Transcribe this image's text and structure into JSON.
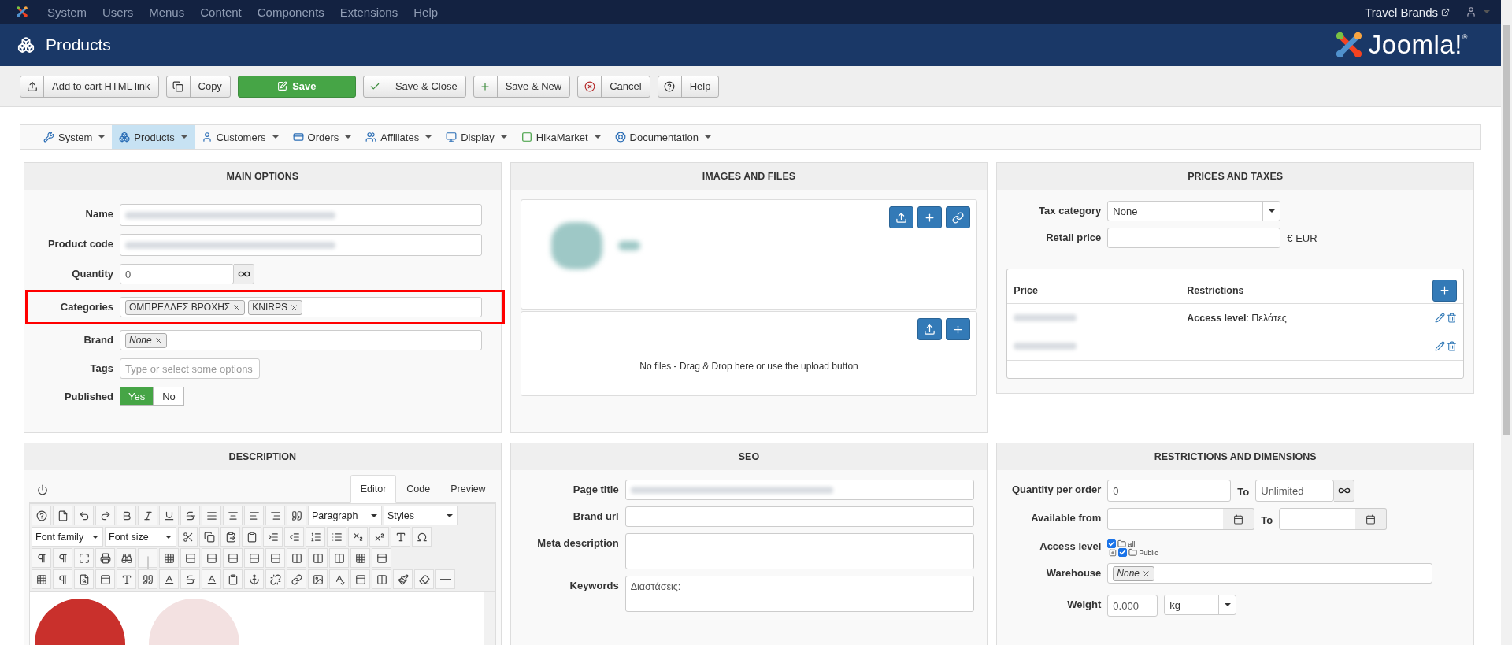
{
  "topbar": {
    "menu": [
      "System",
      "Users",
      "Menus",
      "Content",
      "Components",
      "Extensions",
      "Help"
    ],
    "site_link": "Travel Brands"
  },
  "header": {
    "title": "Products",
    "logo_text": "Joomla!$^{®}$"
  },
  "toolbar": [
    {
      "label": "Add to cart HTML link",
      "kind": "upload"
    },
    {
      "label": "Copy",
      "kind": "copy"
    },
    {
      "label": "Save",
      "kind": "save"
    },
    {
      "label": "Save & Close",
      "kind": "check"
    },
    {
      "label": "Save & New",
      "kind": "plus"
    },
    {
      "label": "Cancel",
      "kind": "cancel"
    },
    {
      "label": "Help",
      "kind": "help"
    }
  ],
  "submenu": [
    {
      "label": "System",
      "kind": "wrench",
      "selected": false
    },
    {
      "label": "Products",
      "kind": "boxes",
      "selected": true
    },
    {
      "label": "Customers",
      "kind": "user",
      "selected": false
    },
    {
      "label": "Orders",
      "kind": "card",
      "selected": false
    },
    {
      "label": "Affiliates",
      "kind": "users",
      "selected": false
    },
    {
      "label": "Display",
      "kind": "monitor",
      "selected": false
    },
    {
      "label": "HikaMarket",
      "kind": "market",
      "selected": false
    },
    {
      "label": "Documentation",
      "kind": "lifebuoy",
      "selected": false
    }
  ],
  "main_options": {
    "title": "MAIN OPTIONS",
    "fields": [
      {
        "label": "Name",
        "kind": "blurred",
        "highlighted": false
      },
      {
        "label": "Product code",
        "kind": "blurred",
        "highlighted": false
      },
      {
        "label": "Quantity",
        "kind": "quantity",
        "value": "0",
        "highlighted": false
      },
      {
        "label": "Categories",
        "kind": "tags",
        "tags": [
          "ΟΜΠΡΕΛΛΕΣ ΒΡΟΧΗΣ",
          "KNIRPS"
        ],
        "highlighted": true
      },
      {
        "label": "Brand",
        "kind": "select",
        "tags": [
          "None"
        ],
        "highlighted": false
      },
      {
        "label": "Tags",
        "kind": "input",
        "placeholder": "Type or select some options",
        "highlighted": false
      },
      {
        "label": "Published",
        "kind": "toggle",
        "options": [
          {
            "label": "Yes",
            "selected": true
          },
          {
            "label": "No",
            "selected": false
          }
        ],
        "highlighted": false
      }
    ]
  },
  "images": {
    "title": "IMAGES AND FILES",
    "files_text": "No files - Drag & Drop here or use the upload button"
  },
  "prices": {
    "title": "PRICES AND TAXES",
    "tax_category": {
      "label": "Tax category",
      "value": "None"
    },
    "retail_price": {
      "label": "Retail price",
      "unit": "€ EUR"
    },
    "table": {
      "columns": [
        "Price",
        "Restrictions"
      ],
      "rows": [
        {
          "restriction": "**Access level**: Πελάτες"
        },
        {}
      ]
    }
  },
  "description": {
    "title": "DESCRIPTION",
    "tabs": [
      {
        "label": "Editor",
        "selected": true
      },
      {
        "label": "Code",
        "selected": false
      },
      {
        "label": "Preview",
        "selected": false
      }
    ],
    "format_select": "Paragraph",
    "styles_select": "Styles",
    "font_family": "Font family",
    "font_size": "Font size"
  },
  "seo": {
    "title": "SEO",
    "fields": [
      {
        "label": "Page title",
        "kind": "blurred"
      },
      {
        "label": "Brand url",
        "kind": "input"
      },
      {
        "label": "Meta description",
        "kind": "textarea"
      },
      {
        "label": "Keywords",
        "kind": "textarea",
        "value": "Διαστάσεις:"
      }
    ]
  },
  "restrictions": {
    "title": "RESTRICTIONS AND DIMENSIONS",
    "quantity_per_order": {
      "label": "Quantity per order",
      "from": "0",
      "to_label": "To",
      "to": "Unlimited"
    },
    "available_from": {
      "label": "Available from",
      "to_label": "To"
    },
    "access_level": {
      "label": "Access level",
      "tree": [
        {
          "label": "all",
          "checked": true,
          "children": [
            {
              "label": "Public",
              "checked": true,
              "expanded": false
            }
          ]
        }
      ]
    },
    "warehouse": {
      "label": "Warehouse",
      "value": "None"
    },
    "weight": {
      "label": "Weight",
      "value": "0.000",
      "unit": "kg"
    }
  }
}
